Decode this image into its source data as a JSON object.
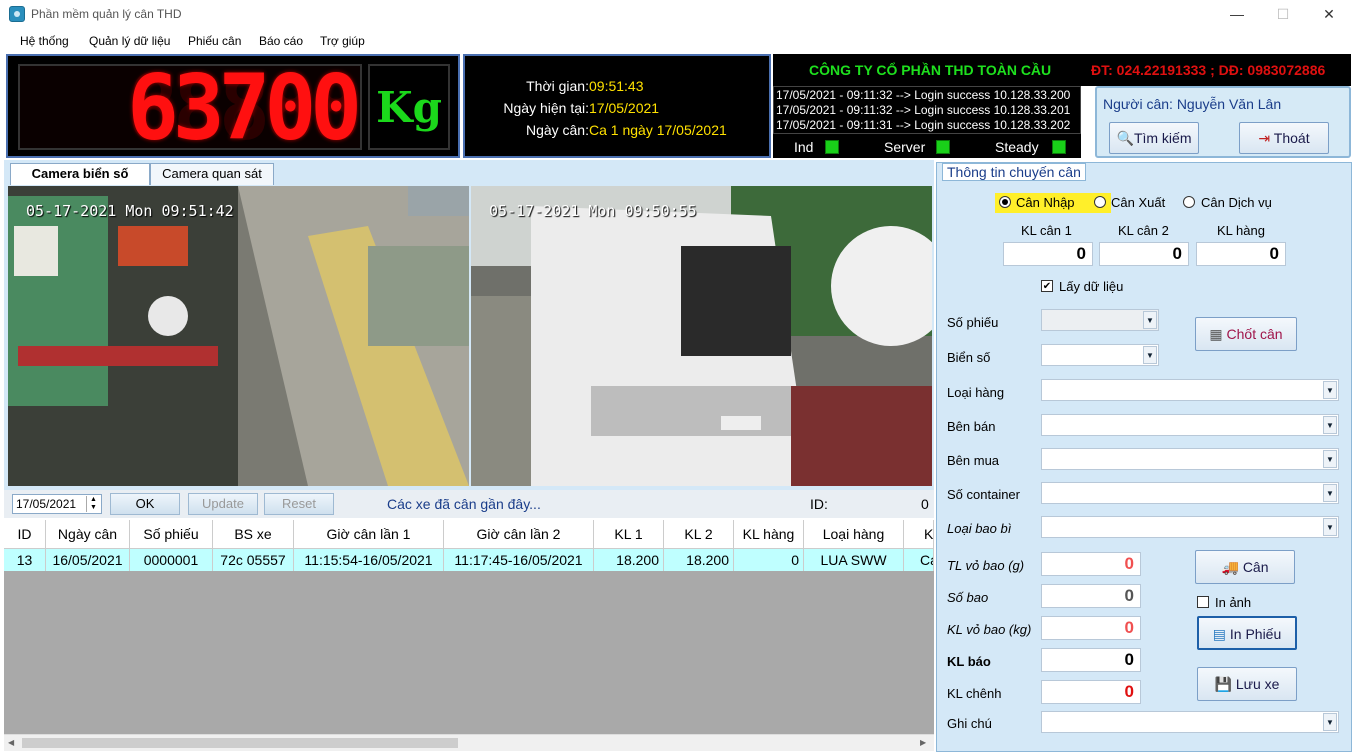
{
  "window": {
    "title": "Phần mềm quản lý cân THD",
    "minimize": "—",
    "maximize": "☐",
    "close": "✕"
  },
  "menu": [
    "Hệ thống",
    "Quản lý dữ liệu",
    "Phiếu cân",
    "Báo cáo",
    "Trợ giúp"
  ],
  "scale": {
    "weight": "63700",
    "ghost": "88888",
    "unit": "Kg"
  },
  "info": {
    "time_label": "Thời gian:",
    "time": "09:51:43",
    "date_label": "Ngày hiện tại:",
    "date": "17/05/2021",
    "shift_label": "Ngày cân:",
    "shift": "Ca 1 ngày 17/05/2021"
  },
  "company": {
    "name": "CÔNG TY CỔ PHẦN THD TOÀN CẦU",
    "phone": "ĐT: 024.22191333 ; DĐ: 0983072886"
  },
  "log": [
    "17/05/2021 - 09:11:32 --> Login success 10.128.33.200",
    "17/05/2021 - 09:11:32 --> Login success 10.128.33.201",
    "17/05/2021 - 09:11:31 --> Login success 10.128.33.202"
  ],
  "status": {
    "ind": "Ind",
    "server": "Server",
    "steady": "Steady",
    "led_color": "#19d019"
  },
  "user": {
    "label": "Người cân:",
    "name": "Nguyễn Văn Lân",
    "search": "Tìm kiếm",
    "exit": "Thoát"
  },
  "camera": {
    "tab1": "Camera biển số",
    "tab2": "Camera quan sát",
    "ts1": "05-17-2021 Mon 09:51:42",
    "ts2": "05-17-2021 Mon 09:50:55"
  },
  "toolbar": {
    "date": "17/05/2021",
    "ok": "OK",
    "update": "Update",
    "reset": "Reset",
    "recent": "Các xe đã cân gần đây...",
    "id_label": "ID:",
    "id_value": "0"
  },
  "table": {
    "headers": [
      "ID",
      "Ngày cân",
      "Số phiếu",
      "BS xe",
      "Giờ cân lần 1",
      "Giờ cân lần 2",
      "KL 1",
      "KL 2",
      "KL hàng",
      "Loại hàng",
      "K"
    ],
    "rows": [
      [
        "13",
        "16/05/2021",
        "0000001",
        "72c 05557",
        "11:15:54-16/05/2021",
        "11:17:45-16/05/2021",
        "18.200",
        "18.200",
        "0",
        "LUA SWW",
        "Cá"
      ]
    ]
  },
  "form": {
    "title": "Thông tin chuyến cân",
    "radio": [
      "Cân Nhập",
      "Cân Xuất",
      "Cân Dịch vụ"
    ],
    "kl_labels": [
      "KL cân 1",
      "KL cân 2",
      "KL hàng"
    ],
    "kl_values": [
      "0",
      "0",
      "0"
    ],
    "get_data": "Lấy dữ liệu",
    "fields": [
      "Số phiếu",
      "Biển số",
      "Loại hàng",
      "Bên bán",
      "Bên mua",
      "Số container",
      "Loại bao bì"
    ],
    "close_btn": "Chốt cân",
    "weigh_btn": "Cân",
    "tl_vo_bao": "TL vỏ bao (g)",
    "tl_vo_bao_val": "0",
    "so_bao": "Số bao",
    "so_bao_val": "0",
    "kl_vo_bao": "KL vỏ bao (kg)",
    "kl_vo_bao_val": "0",
    "kl_bao": "KL báo",
    "kl_bao_val": "0",
    "kl_chenh": "KL chênh",
    "kl_chenh_val": "0",
    "ghi_chu": "Ghi chú",
    "in_anh": "In ảnh",
    "print_btn": "In Phiếu",
    "save_btn": "Lưu xe"
  }
}
